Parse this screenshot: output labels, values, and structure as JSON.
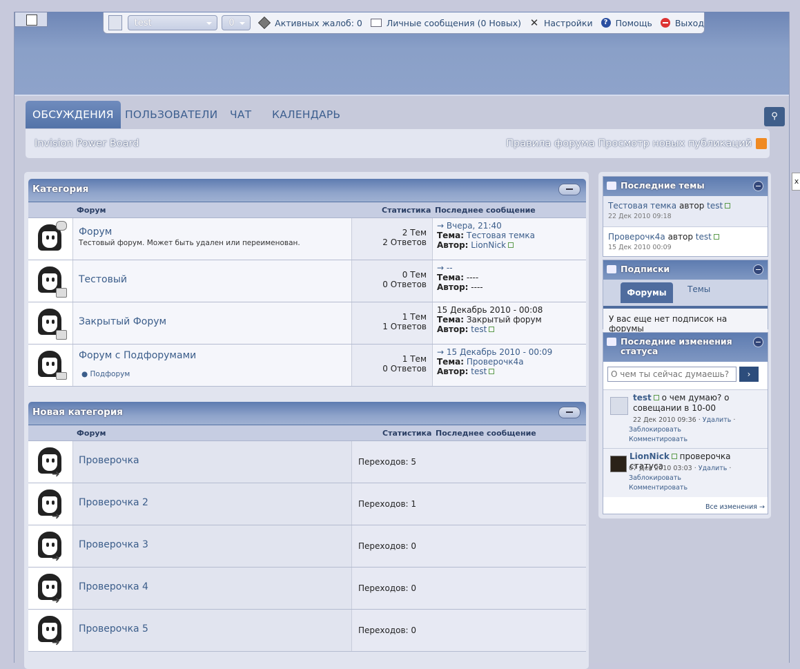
{
  "userbar": {
    "username": "test",
    "count": "0",
    "complaints": "Активных жалоб: 0",
    "messages": "Личные сообщения (0 Новых)",
    "settings": "Настройки",
    "help": "Помощь",
    "logout": "Выход"
  },
  "nav": {
    "tabs": [
      {
        "label": "ОБСУЖДЕНИЯ"
      },
      {
        "label": "ПОЛЬЗОВАТЕЛИ"
      },
      {
        "label": "ЧАТ"
      },
      {
        "label": "КАЛЕНДАРЬ"
      }
    ],
    "board_name": "Invision Power Board",
    "rules": "Правила форума",
    "new_posts": "Просмотр новых публикаций"
  },
  "columns": {
    "forum": "Форум",
    "stats": "Статистика",
    "last": "Последнее сообщение"
  },
  "labels": {
    "topic": "Тема:",
    "author": "Автор:"
  },
  "cat1": {
    "title": "Категория",
    "rows": [
      {
        "name": "Форум",
        "desc": "Тестовый форум. Может быть удален или переименован.",
        "topics": "2 Тем",
        "replies": "2 Ответов",
        "last_date": "→ Вчера, 21:40",
        "last_topic": "Тестовая темка",
        "last_author": "LionNick"
      },
      {
        "name": "Тестовый",
        "topics": "0 Тем",
        "replies": "0 Ответов",
        "last_date": "→ --",
        "last_topic": "----",
        "last_author": "----"
      },
      {
        "name": "Закрытый Форум",
        "topics": "1 Тем",
        "replies": "1 Ответов",
        "last_date": "15 Декабрь 2010 - 00:08",
        "last_topic": "Закрытый форум",
        "last_author": "test"
      },
      {
        "name": "Форум с Подфорумами",
        "subforum": "Подфорум",
        "topics": "1 Тем",
        "replies": "0 Ответов",
        "last_date": "→ 15 Декабрь 2010 - 00:09",
        "last_topic": "Проверочк4а",
        "last_author": "test"
      }
    ]
  },
  "cat2": {
    "title": "Новая категория",
    "rows": [
      {
        "name": "Проверочка",
        "redirects": "Переходов: 5"
      },
      {
        "name": "Проверочка 2",
        "redirects": "Переходов: 1"
      },
      {
        "name": "Проверочка 3",
        "redirects": "Переходов: 0"
      },
      {
        "name": "Проверочка 4",
        "redirects": "Переходов: 0"
      },
      {
        "name": "Проверочка 5",
        "redirects": "Переходов: 0"
      }
    ]
  },
  "sidebar": {
    "latest": {
      "title": "Последние темы",
      "items": [
        {
          "topic": "Тестовая темка",
          "by": "автор",
          "user": "test",
          "date": "22 Дек 2010 09:18"
        },
        {
          "topic": "Проверочк4а",
          "by": "автор",
          "user": "test",
          "date": "15 Дек 2010 00:09"
        }
      ]
    },
    "subs": {
      "title": "Подписки",
      "tab_forums": "Форумы",
      "tab_topics": "Темы",
      "empty": "У вас еще нет подписок на форумы"
    },
    "status": {
      "title": "Последние изменения статуса",
      "placeholder": "О чем ты сейчас думаешь?",
      "submit": "›",
      "items": [
        {
          "user": "test",
          "text": "о чем думаю? о совещании в 10-00",
          "date": "22 Дек 2010 09:36 ·",
          "del": "Удалить",
          "block": "Заблокировать",
          "comment": "Комментировать"
        },
        {
          "user": "LionNick",
          "text": "проверочка статуса",
          "date": "07 Дек 2010 03:03 ·",
          "del": "Удалить",
          "block": "Заблокировать",
          "comment": "Комментировать"
        }
      ],
      "all": "Все изменения →"
    }
  },
  "colors": {
    "accent": "#5373a8",
    "link": "#3b5d8a",
    "header": "#8aa0c8"
  }
}
